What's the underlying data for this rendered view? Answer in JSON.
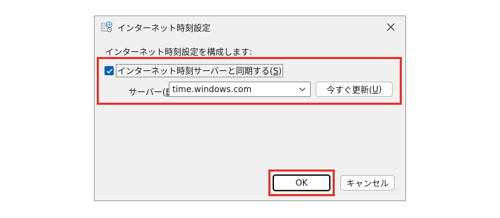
{
  "dialog": {
    "title": "インターネット時刻設定",
    "close_icon": "close-icon",
    "app_icon": "internet-time-icon"
  },
  "config": {
    "heading": "インターネット時刻設定を構成します:",
    "sync_checkbox": {
      "checked": true,
      "label_text": "インターネット時刻サーバーと同期する(",
      "accel": "S",
      "label_end": ")"
    },
    "server": {
      "label_text": "サーバー(",
      "accel": "E",
      "label_end": "):",
      "value": "time.windows.com"
    },
    "update_button": {
      "label_text": "今すぐ更新(",
      "accel": "U",
      "label_end": ")"
    }
  },
  "footer": {
    "ok_label": "OK",
    "cancel_label": "キャンセル"
  },
  "colors": {
    "highlight": "#e8322b",
    "checkbox": "#005fb8"
  }
}
